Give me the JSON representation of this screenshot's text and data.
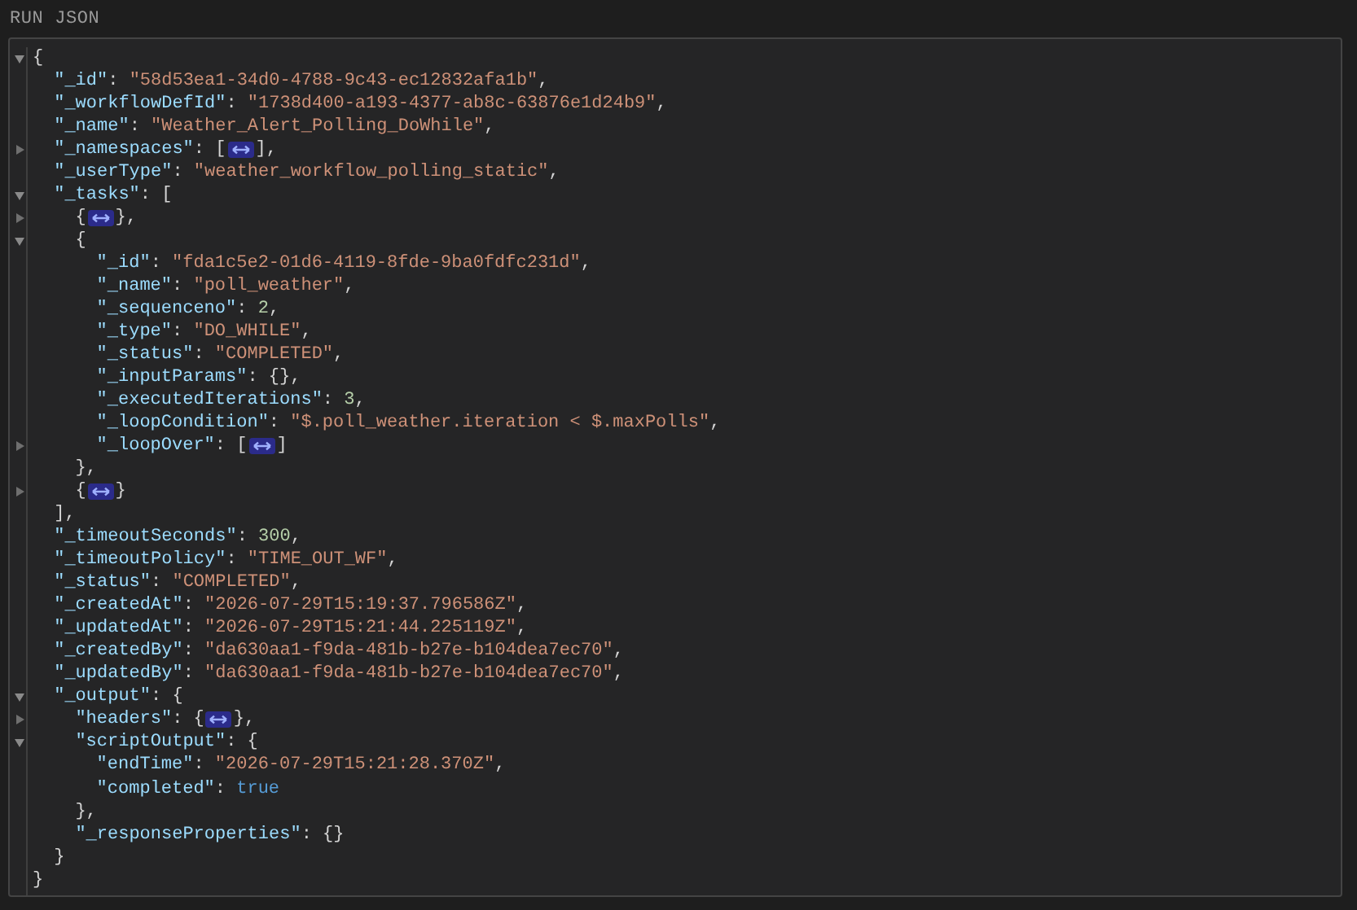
{
  "header": {
    "title": "RUN JSON"
  },
  "lines": [
    {
      "expanded": true,
      "tokens": [
        {
          "kind": "punct",
          "text": "{"
        }
      ],
      "children": [
        {
          "tokens": [
            {
              "kind": "key",
              "text": "\"_id\""
            },
            {
              "kind": "punct",
              "text": ": "
            },
            {
              "kind": "string",
              "text": "\"58d53ea1-34d0-4788-9c43-ec12832afa1b\""
            },
            {
              "kind": "punct",
              "text": ","
            }
          ]
        },
        {
          "tokens": [
            {
              "kind": "key",
              "text": "\"_workflowDefId\""
            },
            {
              "kind": "punct",
              "text": ": "
            },
            {
              "kind": "string",
              "text": "\"1738d400-a193-4377-ab8c-63876e1d24b9\""
            },
            {
              "kind": "punct",
              "text": ","
            }
          ]
        },
        {
          "tokens": [
            {
              "kind": "key",
              "text": "\"_name\""
            },
            {
              "kind": "punct",
              "text": ": "
            },
            {
              "kind": "string",
              "text": "\"Weather_Alert_Polling_DoWhile\""
            },
            {
              "kind": "punct",
              "text": ","
            }
          ]
        },
        {
          "expanded": false,
          "tokens": [
            {
              "kind": "key",
              "text": "\"_namespaces\""
            },
            {
              "kind": "punct",
              "text": ": ["
            },
            {
              "kind": "collapsed"
            },
            {
              "kind": "punct",
              "text": "],"
            }
          ]
        },
        {
          "tokens": [
            {
              "kind": "key",
              "text": "\"_userType\""
            },
            {
              "kind": "punct",
              "text": ": "
            },
            {
              "kind": "string",
              "text": "\"weather_workflow_polling_static\""
            },
            {
              "kind": "punct",
              "text": ","
            }
          ]
        },
        {
          "expanded": true,
          "tokens": [
            {
              "kind": "key",
              "text": "\"_tasks\""
            },
            {
              "kind": "punct",
              "text": ": ["
            }
          ],
          "children": [
            {
              "expanded": false,
              "tokens": [
                {
                  "kind": "punct",
                  "text": "{"
                },
                {
                  "kind": "collapsed"
                },
                {
                  "kind": "punct",
                  "text": "},"
                }
              ]
            },
            {
              "expanded": true,
              "tokens": [
                {
                  "kind": "punct",
                  "text": "{"
                }
              ],
              "children": [
                {
                  "tokens": [
                    {
                      "kind": "key",
                      "text": "\"_id\""
                    },
                    {
                      "kind": "punct",
                      "text": ": "
                    },
                    {
                      "kind": "string",
                      "text": "\"fda1c5e2-01d6-4119-8fde-9ba0fdfc231d\""
                    },
                    {
                      "kind": "punct",
                      "text": ","
                    }
                  ]
                },
                {
                  "tokens": [
                    {
                      "kind": "key",
                      "text": "\"_name\""
                    },
                    {
                      "kind": "punct",
                      "text": ": "
                    },
                    {
                      "kind": "string",
                      "text": "\"poll_weather\""
                    },
                    {
                      "kind": "punct",
                      "text": ","
                    }
                  ]
                },
                {
                  "tokens": [
                    {
                      "kind": "key",
                      "text": "\"_sequenceno\""
                    },
                    {
                      "kind": "punct",
                      "text": ": "
                    },
                    {
                      "kind": "number",
                      "text": "2"
                    },
                    {
                      "kind": "punct",
                      "text": ","
                    }
                  ]
                },
                {
                  "tokens": [
                    {
                      "kind": "key",
                      "text": "\"_type\""
                    },
                    {
                      "kind": "punct",
                      "text": ": "
                    },
                    {
                      "kind": "string",
                      "text": "\"DO_WHILE\""
                    },
                    {
                      "kind": "punct",
                      "text": ","
                    }
                  ]
                },
                {
                  "tokens": [
                    {
                      "kind": "key",
                      "text": "\"_status\""
                    },
                    {
                      "kind": "punct",
                      "text": ": "
                    },
                    {
                      "kind": "string",
                      "text": "\"COMPLETED\""
                    },
                    {
                      "kind": "punct",
                      "text": ","
                    }
                  ]
                },
                {
                  "tokens": [
                    {
                      "kind": "key",
                      "text": "\"_inputParams\""
                    },
                    {
                      "kind": "punct",
                      "text": ": {},"
                    }
                  ]
                },
                {
                  "tokens": [
                    {
                      "kind": "key",
                      "text": "\"_executedIterations\""
                    },
                    {
                      "kind": "punct",
                      "text": ": "
                    },
                    {
                      "kind": "number",
                      "text": "3"
                    },
                    {
                      "kind": "punct",
                      "text": ","
                    }
                  ]
                },
                {
                  "tokens": [
                    {
                      "kind": "key",
                      "text": "\"_loopCondition\""
                    },
                    {
                      "kind": "punct",
                      "text": ": "
                    },
                    {
                      "kind": "string",
                      "text": "\"$.poll_weather.iteration < $.maxPolls\""
                    },
                    {
                      "kind": "punct",
                      "text": ","
                    }
                  ]
                },
                {
                  "expanded": false,
                  "tokens": [
                    {
                      "kind": "key",
                      "text": "\"_loopOver\""
                    },
                    {
                      "kind": "punct",
                      "text": ": ["
                    },
                    {
                      "kind": "collapsed"
                    },
                    {
                      "kind": "punct",
                      "text": "]"
                    }
                  ]
                }
              ]
            },
            {
              "tokens": [
                {
                  "kind": "punct",
                  "text": "},"
                }
              ]
            },
            {
              "expanded": false,
              "tokens": [
                {
                  "kind": "punct",
                  "text": "{"
                },
                {
                  "kind": "collapsed"
                },
                {
                  "kind": "punct",
                  "text": "}"
                }
              ]
            }
          ]
        },
        {
          "tokens": [
            {
              "kind": "punct",
              "text": "],"
            }
          ]
        },
        {
          "tokens": [
            {
              "kind": "key",
              "text": "\"_timeoutSeconds\""
            },
            {
              "kind": "punct",
              "text": ": "
            },
            {
              "kind": "number",
              "text": "300"
            },
            {
              "kind": "punct",
              "text": ","
            }
          ]
        },
        {
          "tokens": [
            {
              "kind": "key",
              "text": "\"_timeoutPolicy\""
            },
            {
              "kind": "punct",
              "text": ": "
            },
            {
              "kind": "string",
              "text": "\"TIME_OUT_WF\""
            },
            {
              "kind": "punct",
              "text": ","
            }
          ]
        },
        {
          "tokens": [
            {
              "kind": "key",
              "text": "\"_status\""
            },
            {
              "kind": "punct",
              "text": ": "
            },
            {
              "kind": "string",
              "text": "\"COMPLETED\""
            },
            {
              "kind": "punct",
              "text": ","
            }
          ]
        },
        {
          "tokens": [
            {
              "kind": "key",
              "text": "\"_createdAt\""
            },
            {
              "kind": "punct",
              "text": ": "
            },
            {
              "kind": "string",
              "text": "\"2026-07-29T15:19:37.796586Z\""
            },
            {
              "kind": "punct",
              "text": ","
            }
          ]
        },
        {
          "tokens": [
            {
              "kind": "key",
              "text": "\"_updatedAt\""
            },
            {
              "kind": "punct",
              "text": ": "
            },
            {
              "kind": "string",
              "text": "\"2026-07-29T15:21:44.225119Z\""
            },
            {
              "kind": "punct",
              "text": ","
            }
          ]
        },
        {
          "tokens": [
            {
              "kind": "key",
              "text": "\"_createdBy\""
            },
            {
              "kind": "punct",
              "text": ": "
            },
            {
              "kind": "string",
              "text": "\"da630aa1-f9da-481b-b27e-b104dea7ec70\""
            },
            {
              "kind": "punct",
              "text": ","
            }
          ]
        },
        {
          "tokens": [
            {
              "kind": "key",
              "text": "\"_updatedBy\""
            },
            {
              "kind": "punct",
              "text": ": "
            },
            {
              "kind": "string",
              "text": "\"da630aa1-f9da-481b-b27e-b104dea7ec70\""
            },
            {
              "kind": "punct",
              "text": ","
            }
          ]
        },
        {
          "expanded": true,
          "tokens": [
            {
              "kind": "key",
              "text": "\"_output\""
            },
            {
              "kind": "punct",
              "text": ": {"
            }
          ],
          "children": [
            {
              "expanded": false,
              "tokens": [
                {
                  "kind": "key",
                  "text": "\"headers\""
                },
                {
                  "kind": "punct",
                  "text": ": {"
                },
                {
                  "kind": "collapsed"
                },
                {
                  "kind": "punct",
                  "text": "},"
                }
              ]
            },
            {
              "expanded": true,
              "tokens": [
                {
                  "kind": "key",
                  "text": "\"scriptOutput\""
                },
                {
                  "kind": "punct",
                  "text": ": {"
                }
              ],
              "children": [
                {
                  "tokens": [
                    {
                      "kind": "key",
                      "text": "\"endTime\""
                    },
                    {
                      "kind": "punct",
                      "text": ": "
                    },
                    {
                      "kind": "string",
                      "text": "\"2026-07-29T15:21:28.370Z\""
                    },
                    {
                      "kind": "punct",
                      "text": ","
                    }
                  ]
                },
                {
                  "tokens": [
                    {
                      "kind": "key",
                      "text": "\"completed\""
                    },
                    {
                      "kind": "punct",
                      "text": ": "
                    },
                    {
                      "kind": "boolean",
                      "text": "true"
                    }
                  ]
                }
              ]
            },
            {
              "tokens": [
                {
                  "kind": "punct",
                  "text": "},"
                }
              ]
            },
            {
              "tokens": [
                {
                  "kind": "key",
                  "text": "\"_responseProperties\""
                },
                {
                  "kind": "punct",
                  "text": ": {}"
                }
              ]
            }
          ]
        },
        {
          "tokens": [
            {
              "kind": "punct",
              "text": "}"
            }
          ]
        }
      ]
    },
    {
      "tokens": [
        {
          "kind": "punct",
          "text": "}"
        }
      ]
    }
  ]
}
